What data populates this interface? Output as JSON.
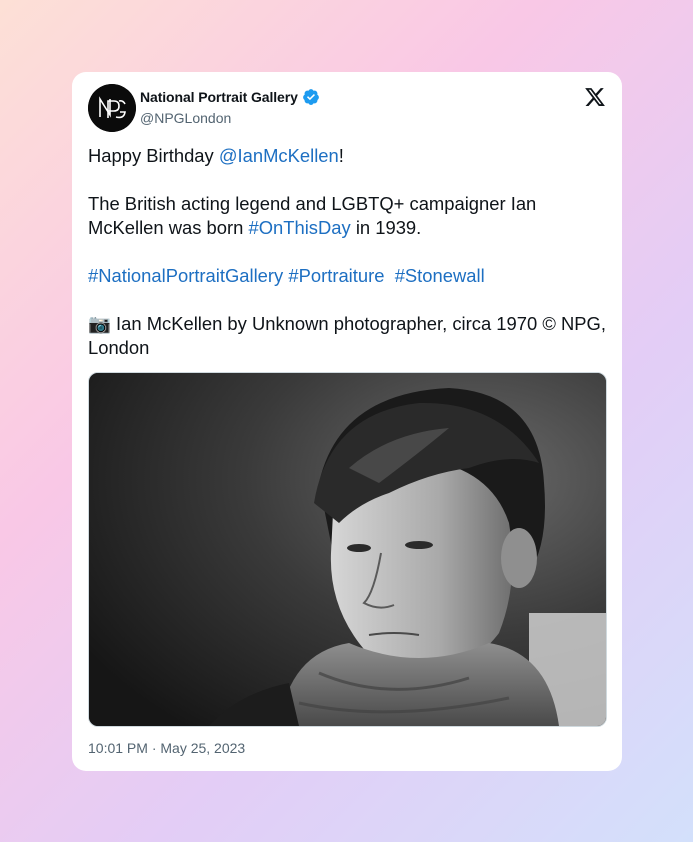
{
  "tweet": {
    "author_name": "National Portrait Gallery",
    "handle": "@NPGLondon",
    "avatar_letters": "NPG",
    "verified_icon": "verified-badge-icon",
    "verified_color": "#1d9bf0",
    "link_color": "#1d6fc2",
    "platform_icon": "x-logo-icon",
    "body": {
      "line1_prefix": "Happy Birthday ",
      "line1_mention": "@IanMcKellen",
      "line1_suffix": "!",
      "line2_prefix": "The British acting legend and LGBTQ+ campaigner Ian McKellen was born ",
      "line2_hashtag": "#OnThisDay",
      "line2_suffix": " in 1939.",
      "hashtags": [
        "#NationalPortraitGallery",
        "#Portraiture",
        "#Stonewall"
      ],
      "caption_emoji": "📷",
      "caption_text": " Ian McKellen by Unknown photographer, circa 1970 © NPG, London"
    },
    "image_icon": "portrait-photo",
    "timestamp": "10:01 PM · May 25, 2023"
  }
}
